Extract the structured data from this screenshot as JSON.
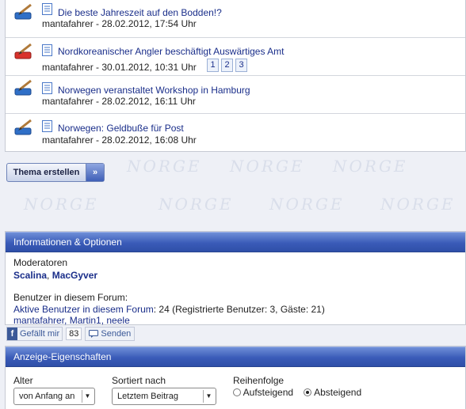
{
  "threads": [
    {
      "title": "Die beste Jahreszeit auf den Bodden!?",
      "meta": "mantafahrer - 28.02.2012, 17:54 Uhr",
      "hot": false,
      "pages": []
    },
    {
      "title": "Nordkoreanischer Angler beschäftigt Auswärtiges Amt",
      "meta": "mantafahrer - 30.01.2012, 10:31 Uhr",
      "hot": true,
      "pages": [
        "1",
        "2",
        "3"
      ]
    },
    {
      "title": "Norwegen veranstaltet Workshop in Hamburg",
      "meta": "mantafahrer - 28.02.2012, 16:11 Uhr",
      "hot": false,
      "pages": []
    },
    {
      "title": "Norwegen: Geldbuße für Post",
      "meta": "mantafahrer - 28.02.2012, 16:08 Uhr",
      "hot": false,
      "pages": []
    }
  ],
  "new_thread_button": "Thema erstellen",
  "watermark_text": "NORGE",
  "info_panel": {
    "title": "Informationen & Optionen",
    "moderators_label": "Moderatoren",
    "moderators": [
      "Scalina",
      "MacGyver"
    ],
    "moderator_separator": ", ",
    "users_label": "Benutzer in diesem Forum:",
    "active_users_link": "Aktive Benutzer in diesem Forum",
    "active_users_text": ": 24 (Registrierte Benutzer: 3, Gäste: 21)",
    "user_list": "mantafahrer, Martin1, neele"
  },
  "social": {
    "like_label": "Gefällt mir",
    "like_count": "83",
    "send_label": "Senden"
  },
  "display_panel": {
    "title": "Anzeige-Eigenschaften",
    "age_label": "Alter",
    "age_value": "von Anfang an",
    "sort_label": "Sortiert nach",
    "sort_value": "Letztem Beitrag",
    "order_label": "Reihenfolge",
    "order_asc": "Aufsteigend",
    "order_desc": "Absteigend",
    "order_selected": "desc"
  },
  "colors": {
    "header_blue": "#3a5bb8",
    "link": "#1a2e8a",
    "hot_icon": "#d9322c",
    "normal_icon": "#2f6fc7"
  }
}
